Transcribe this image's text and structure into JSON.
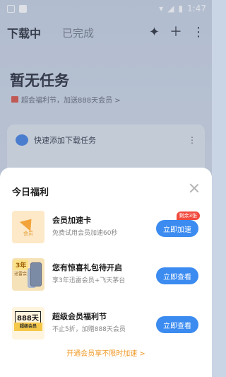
{
  "status_bar": {
    "time": "1:47"
  },
  "header": {
    "tabs": [
      {
        "label": "下载中"
      },
      {
        "label": "已完成"
      }
    ]
  },
  "background": {
    "empty_title": "暂无任务",
    "promo": "超会福利节，加送888天会员 >",
    "quick_add": "快速添加下载任务"
  },
  "sheet": {
    "title": "今日福利",
    "items": [
      {
        "thumb_text": "会员",
        "title": "会员加速卡",
        "subtitle": "免费试用会员加速60秒",
        "badge": "剩余3张",
        "button": "立即加速"
      },
      {
        "thumb_text": "3年",
        "thumb_sub": "迅雷会员",
        "title": "您有惊喜礼包待开启",
        "subtitle": "享3年迅雷会员+飞天茅台",
        "button": "立即查看"
      },
      {
        "thumb_text": "888天",
        "thumb_sub": "超级会员",
        "title": "超级会员福利节",
        "subtitle": "不止5折，加赠888天会员",
        "button": "立即查看"
      }
    ],
    "footer_link": "开通会员享不限时加速 >"
  }
}
